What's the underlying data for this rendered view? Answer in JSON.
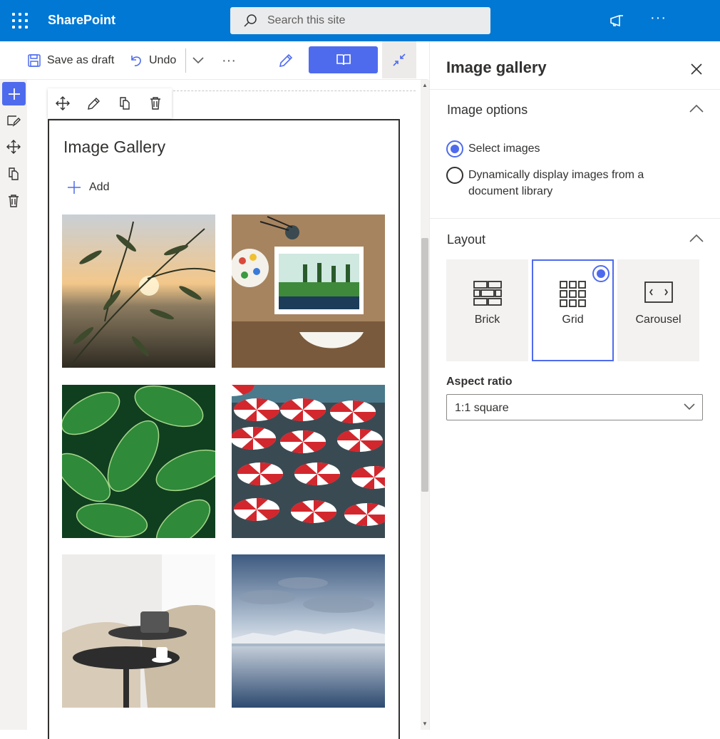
{
  "suite": {
    "brand": "SharePoint",
    "search_placeholder": "Search this site",
    "more": "···"
  },
  "command_bar": {
    "save_draft": "Save as draft",
    "undo": "Undo",
    "more": "···"
  },
  "webpart": {
    "title": "Image Gallery",
    "add_label": "Add",
    "images": [
      "olive branches at sunset",
      "painting supplies on table",
      "green hosta leaves",
      "red and white beach umbrellas",
      "cafe chairs with coffee cup",
      "mountain lake reflection"
    ]
  },
  "pane": {
    "title": "Image gallery",
    "image_options": {
      "heading": "Image options",
      "options": [
        {
          "label": "Select images",
          "selected": true
        },
        {
          "label": "Dynamically display images from a document library",
          "selected": false
        }
      ]
    },
    "layout": {
      "heading": "Layout",
      "options": [
        {
          "label": "Brick",
          "icon": "brick-layout-icon",
          "selected": false
        },
        {
          "label": "Grid",
          "icon": "grid-layout-icon",
          "selected": true
        },
        {
          "label": "Carousel",
          "icon": "carousel-layout-icon",
          "selected": false
        }
      ]
    },
    "aspect_ratio": {
      "label": "Aspect ratio",
      "value": "1:1 square"
    }
  },
  "colors": {
    "suitebar": "#0078d4",
    "accent": "#4f6bed",
    "text": "#323130"
  }
}
